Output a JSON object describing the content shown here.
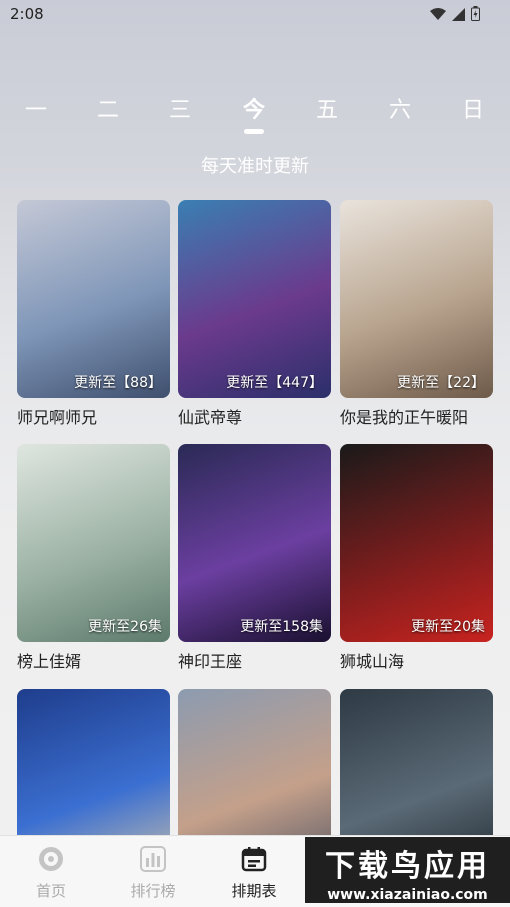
{
  "status": {
    "time": "2:08"
  },
  "week": {
    "days": [
      "一",
      "二",
      "三",
      "今",
      "五",
      "六",
      "日"
    ],
    "active_index": 3,
    "subtitle": "每天准时更新"
  },
  "shows": [
    {
      "title": "师兄啊师兄",
      "badge": "更新至【88】",
      "colors": [
        "#c4c8d6",
        "#7f96b8",
        "#3f4f6e"
      ]
    },
    {
      "title": "仙武帝尊",
      "badge": "更新至【447】",
      "colors": [
        "#3a7fb2",
        "#6b3a8d",
        "#2b2f6a"
      ]
    },
    {
      "title": "你是我的正午暖阳",
      "badge": "更新至【22】",
      "colors": [
        "#e9e3dc",
        "#b8a48e",
        "#6e5a49"
      ]
    },
    {
      "title": "榜上佳婿",
      "badge": "更新至26集",
      "colors": [
        "#dfe6e0",
        "#9cb2a4",
        "#5c7a6c"
      ]
    },
    {
      "title": "神印王座",
      "badge": "更新至158集",
      "colors": [
        "#2a2a55",
        "#6b3fa0",
        "#1a1030"
      ]
    },
    {
      "title": "狮城山海",
      "badge": "更新至20集",
      "colors": [
        "#1a1a1a",
        "#7a1d1d",
        "#c8231f"
      ]
    },
    {
      "title": "",
      "badge": "",
      "colors": [
        "#1f3d8c",
        "#3b6fd1",
        "#d8c8a8"
      ]
    },
    {
      "title": "",
      "badge": "",
      "colors": [
        "#8c9bb0",
        "#c4a08a",
        "#4a4f60"
      ]
    },
    {
      "title": "",
      "badge": "",
      "colors": [
        "#2e3a44",
        "#5a6a76",
        "#1c2329"
      ]
    }
  ],
  "tabs": [
    {
      "label": "首页",
      "icon": "film-reel-icon"
    },
    {
      "label": "排行榜",
      "icon": "bar-chart-icon"
    },
    {
      "label": "排期表",
      "icon": "calendar-icon"
    }
  ],
  "active_tab": 2,
  "watermark": {
    "main": "下载鸟应用",
    "url": "www.xiazainiao.com"
  }
}
